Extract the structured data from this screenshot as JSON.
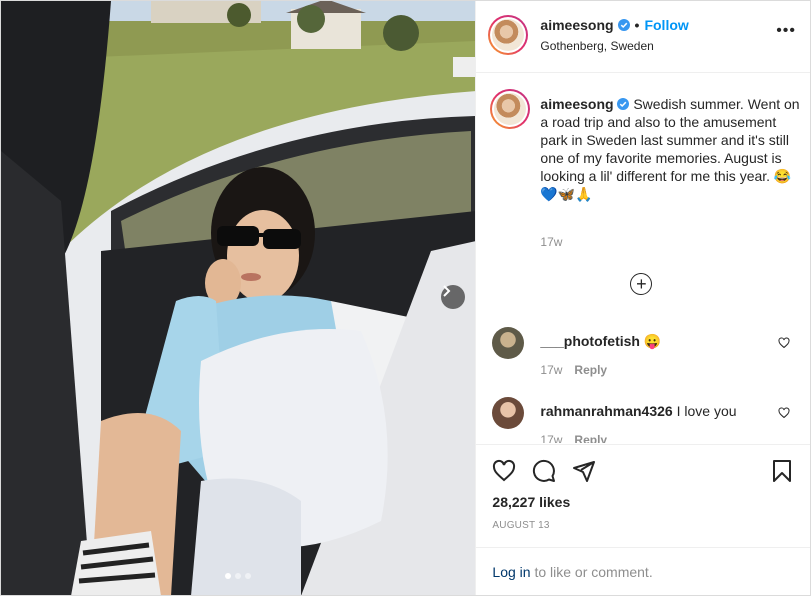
{
  "post": {
    "username": "aimeesong",
    "follow_label": "Follow",
    "separator": "•",
    "location": "Gothenberg, Sweden",
    "more_label": "•••",
    "caption_text": "Swedish summer. Went on a road trip and also to the amusement park in Sweden last summer and it's still one of my favorite memories. August is looking a lil' different for me this year. 😂💙🦋🙏",
    "caption_time": "17w",
    "load_more_label": "+",
    "likes": "28,227 likes",
    "date": "AUGUST 13",
    "login_link": "Log in",
    "login_rest": " to like or comment."
  },
  "comments": [
    {
      "username": "___photofetish",
      "text": "😛",
      "time": "17w",
      "reply": "Reply"
    },
    {
      "username": "rahmanrahman4326",
      "text": "I love you",
      "time": "17w",
      "reply": "Reply"
    }
  ],
  "carousel": {
    "count": 3,
    "active": 1
  },
  "colors": {
    "accent": "#0095f6",
    "link": "#00376b",
    "muted": "#8e8e8e"
  },
  "icons": [
    "heart-icon",
    "comment-icon",
    "share-icon",
    "bookmark-icon",
    "verified-badge-icon",
    "chevron-right-icon"
  ]
}
